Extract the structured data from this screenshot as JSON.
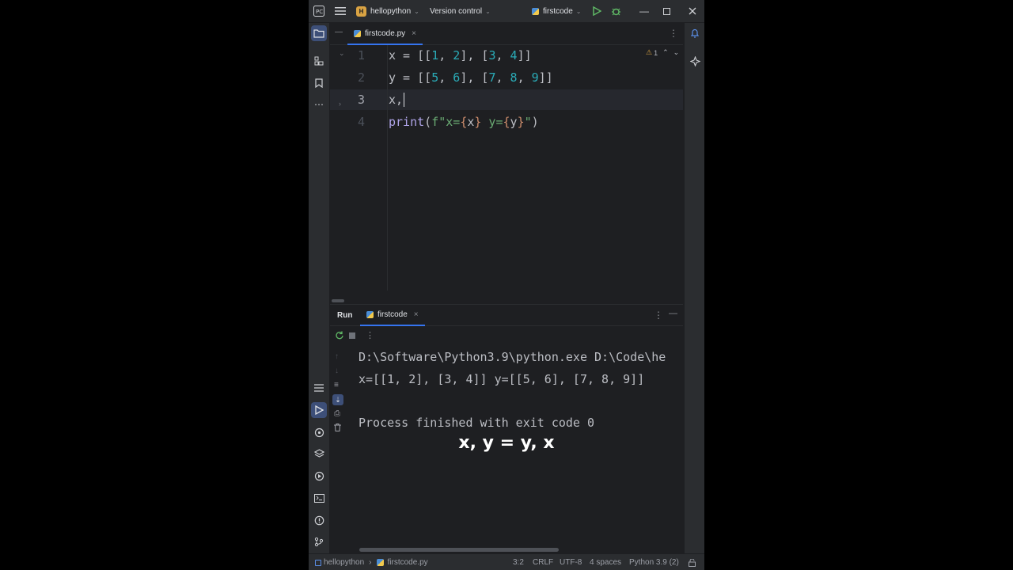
{
  "titlebar": {
    "project_badge": "H",
    "project_name": "hellopython",
    "vcs_label": "Version control",
    "run_config": "firstcode"
  },
  "editor": {
    "active_tab": "firstcode.py",
    "line_numbers": [
      "1",
      "2",
      "3",
      "4"
    ],
    "warning_count": "1"
  },
  "run_panel": {
    "title": "Run",
    "tab": "firstcode",
    "console": [
      "D:\\Software\\Python3.9\\python.exe D:\\Code\\he",
      "x=[[1, 2], [3, 4]] y=[[5, 6], [7, 8, 9]]",
      "",
      "Process finished with exit code 0"
    ]
  },
  "caption": "x, y = y, x",
  "statusbar": {
    "project": "hellopython",
    "file": "firstcode.py",
    "position": "3:2",
    "line_ending": "CRLF",
    "encoding": "UTF-8",
    "indent": "4 spaces",
    "interpreter": "Python 3.9 (2)"
  },
  "icons": {
    "app": "pycharm-icon",
    "menu": "hamburger-menu-icon",
    "run": "run-icon",
    "debug": "debug-icon"
  },
  "colors": {
    "accent": "#3574f0",
    "background": "#1e1f22",
    "number": "#2aacb8",
    "string": "#6aab73",
    "function": "#b0a5ea"
  }
}
